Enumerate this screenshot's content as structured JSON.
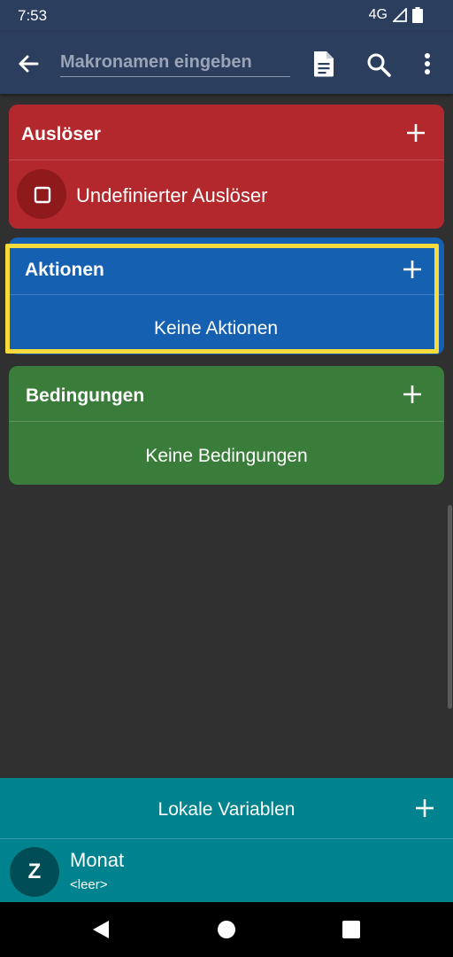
{
  "status": {
    "time": "7:53",
    "network": "4G"
  },
  "header": {
    "title_placeholder": "Makronamen eingeben"
  },
  "triggers": {
    "title": "Auslöser",
    "item_label": "Undefinierter Auslöser"
  },
  "actions": {
    "title": "Aktionen",
    "empty_text": "Keine Aktionen"
  },
  "conditions": {
    "title": "Bedingungen",
    "empty_text": "Keine Bedingungen"
  },
  "local_variables": {
    "title": "Lokale Variablen",
    "items": [
      {
        "avatar": "Z",
        "name": "Monat",
        "value": "<leer>"
      }
    ]
  },
  "colors": {
    "trigger_card": "#b2282c",
    "actions_card": "#1560b0",
    "conditions_card": "#3a7d3a",
    "variables_panel": "#00838f",
    "highlight": "#f5dc3c"
  }
}
